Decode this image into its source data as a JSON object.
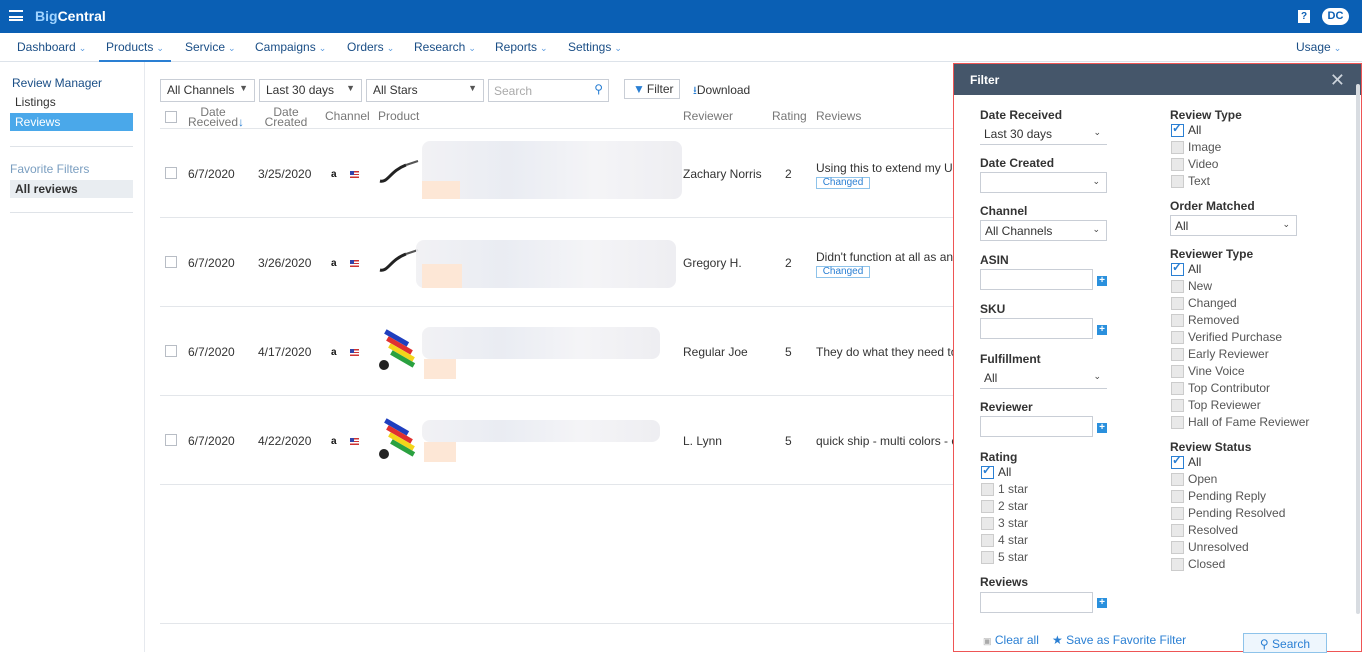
{
  "app": {
    "title_big": "Big",
    "title_central": "Central",
    "help": "?",
    "avatar": "DC"
  },
  "nav": {
    "items": [
      "Dashboard",
      "Products",
      "Service",
      "Campaigns",
      "Orders",
      "Research",
      "Reports",
      "Settings"
    ],
    "right": "Usage"
  },
  "sidebar": {
    "review_manager": "Review Manager",
    "listings": "Listings",
    "reviews": "Reviews",
    "favorite_filters": "Favorite Filters",
    "all_reviews": "All reviews"
  },
  "toolbar": {
    "channels": "All Channels",
    "period": "Last 30 days",
    "stars": "All Stars",
    "search_placeholder": "Search",
    "filter": "Filter",
    "download": "Download"
  },
  "table": {
    "headers": {
      "date_received_1": "Date",
      "date_received_2": "Received",
      "date_created_1": "Date",
      "date_created_2": "Created",
      "channel": "Channel",
      "product": "Product",
      "reviewer": "Reviewer",
      "rating": "Rating",
      "reviews": "Reviews"
    },
    "rows": [
      {
        "received": "6/7/2020",
        "created": "3/25/2020",
        "reviewer": "Zachary Norris",
        "rating": "2",
        "review": "Using this to extend my U",
        "changed": "Changed"
      },
      {
        "received": "6/7/2020",
        "created": "3/26/2020",
        "reviewer": "Gregory H.",
        "rating": "2",
        "review": "Didn't function at all as an",
        "changed": "Changed"
      },
      {
        "received": "6/7/2020",
        "created": "4/17/2020",
        "reviewer": "Regular Joe",
        "rating": "5",
        "review": "They do what they need to",
        "changed": ""
      },
      {
        "received": "6/7/2020",
        "created": "4/22/2020",
        "reviewer": "L. Lynn",
        "rating": "5",
        "review": "quick ship - multi colors - c",
        "changed": ""
      }
    ],
    "channel_badge": "a"
  },
  "filter": {
    "title": "Filter",
    "close": "✕",
    "date_received": {
      "label": "Date Received",
      "value": "Last 30 days"
    },
    "date_created": {
      "label": "Date Created",
      "value": ""
    },
    "channel": {
      "label": "Channel",
      "value": "All Channels"
    },
    "asin": {
      "label": "ASIN"
    },
    "sku": {
      "label": "SKU"
    },
    "fulfillment": {
      "label": "Fulfillment",
      "value": "All"
    },
    "reviewer": {
      "label": "Reviewer"
    },
    "rating": {
      "label": "Rating",
      "options": [
        "All",
        "1 star",
        "2 star",
        "3 star",
        "4 star",
        "5 star"
      ]
    },
    "reviews": {
      "label": "Reviews"
    },
    "review_type": {
      "label": "Review Type",
      "options": [
        "All",
        "Image",
        "Video",
        "Text"
      ]
    },
    "order_matched": {
      "label": "Order Matched",
      "value": "All"
    },
    "reviewer_type": {
      "label": "Reviewer Type",
      "options": [
        "All",
        "New",
        "Changed",
        "Removed",
        "Verified Purchase",
        "Early Reviewer",
        "Vine Voice",
        "Top Contributor",
        "Top Reviewer",
        "Hall of Fame Reviewer"
      ]
    },
    "review_status": {
      "label": "Review Status",
      "options": [
        "All",
        "Open",
        "Pending Reply",
        "Pending Resolved",
        "Resolved",
        "Unresolved",
        "Closed"
      ]
    },
    "clear_all": "Clear all",
    "save_favorite": "Save as Favorite Filter",
    "search": "Search"
  }
}
